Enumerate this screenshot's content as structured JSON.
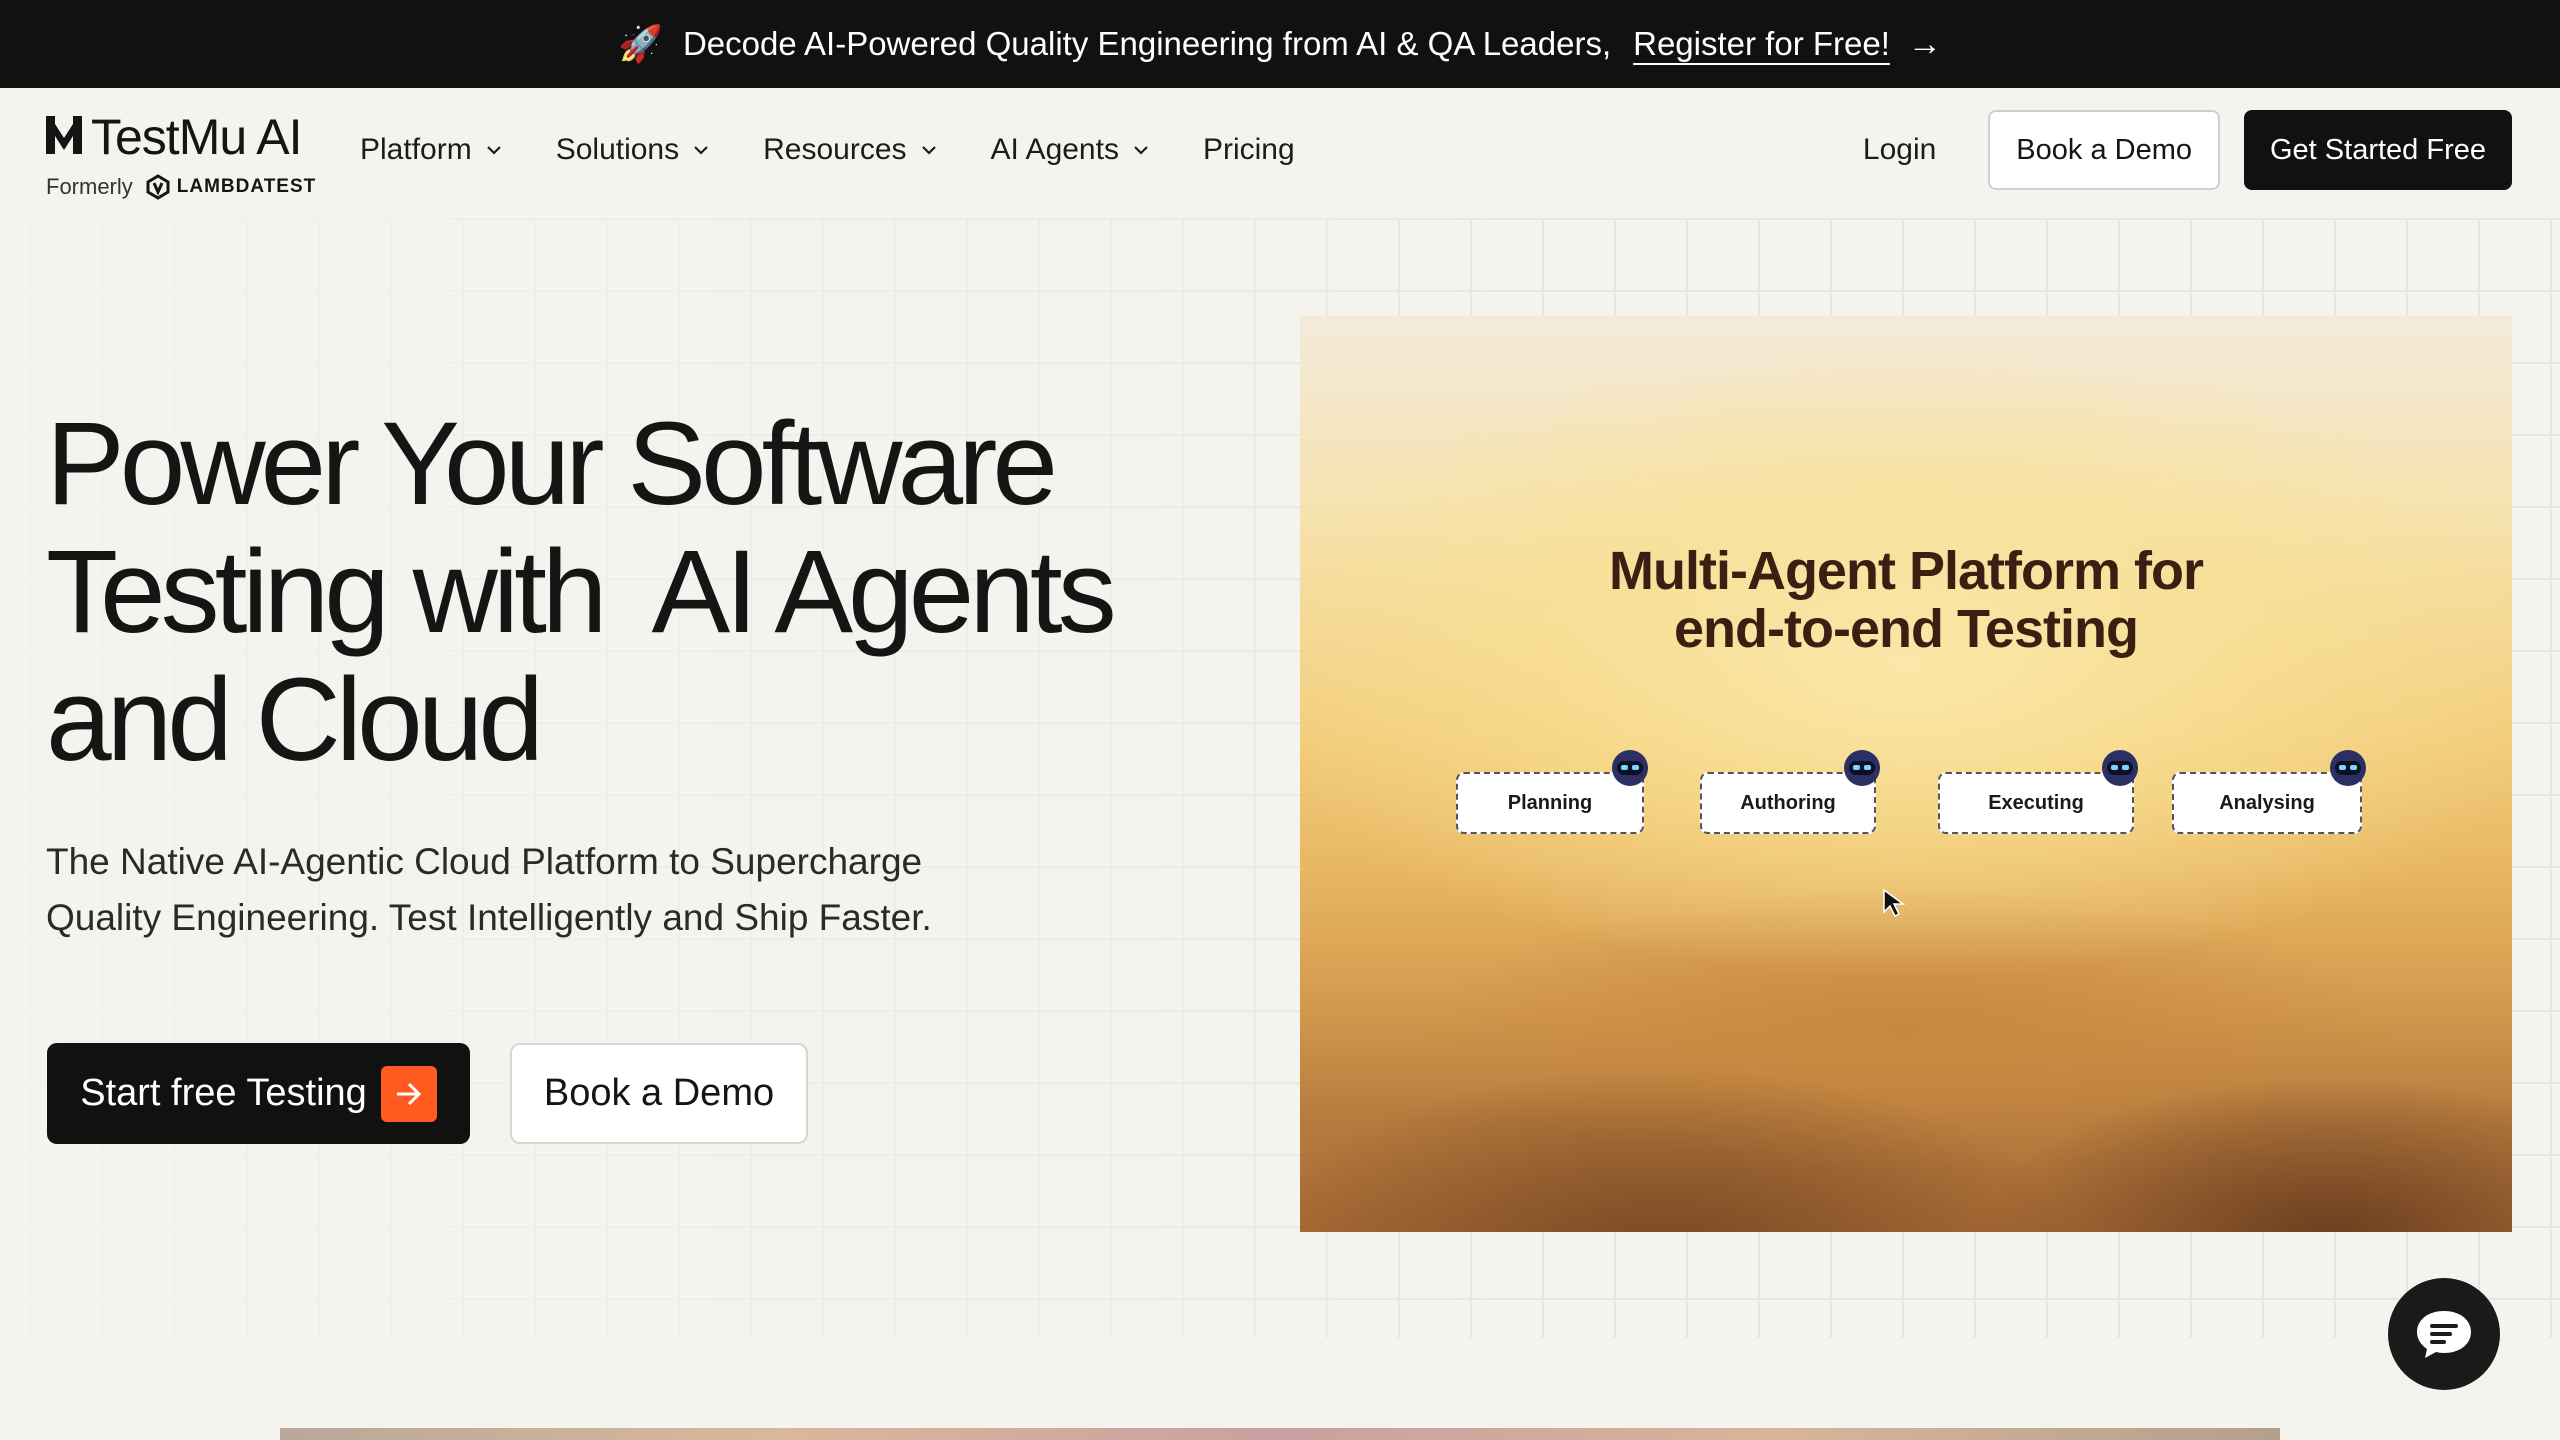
{
  "announcement": {
    "text": "Decode AI-Powered Quality Engineering from AI & QA Leaders,",
    "link": "Register for Free!",
    "rocket_emoji": "🚀"
  },
  "logo": {
    "brand": "TestMu AI",
    "formerly": "Formerly",
    "former_brand": "LAMBDATEST"
  },
  "nav": {
    "items": [
      {
        "label": "Platform",
        "has_dropdown": true
      },
      {
        "label": "Solutions",
        "has_dropdown": true
      },
      {
        "label": "Resources",
        "has_dropdown": true
      },
      {
        "label": "AI Agents",
        "has_dropdown": true
      },
      {
        "label": "Pricing",
        "has_dropdown": false
      }
    ],
    "login": "Login",
    "book_demo": "Book a Demo",
    "get_started": "Get Started Free"
  },
  "hero": {
    "title_line1": "Power Your Software",
    "title_line2": "Testing with  AI Agents",
    "title_line3": "and Cloud",
    "subtitle_line1": "The Native AI-Agentic Cloud Platform to Supercharge",
    "subtitle_line2": "Quality Engineering. Test Intelligently and Ship Faster.",
    "cta_primary": "Start free Testing",
    "cta_secondary": "Book a Demo"
  },
  "video": {
    "title_line1": "Multi-Agent Platform for",
    "title_line2": "end-to-end Testing",
    "agents": [
      "Planning",
      "Authoring",
      "Executing",
      "Analysing"
    ]
  },
  "colors": {
    "announce_bg": "#111111",
    "accent_orange": "#ff5a1f",
    "page_bg": "#f4f3ee",
    "dark_button": "#111111"
  },
  "icons": {
    "chat": "chat-bubble-icon",
    "arrow": "arrow-right-icon",
    "chevron": "chevron-down-icon"
  }
}
